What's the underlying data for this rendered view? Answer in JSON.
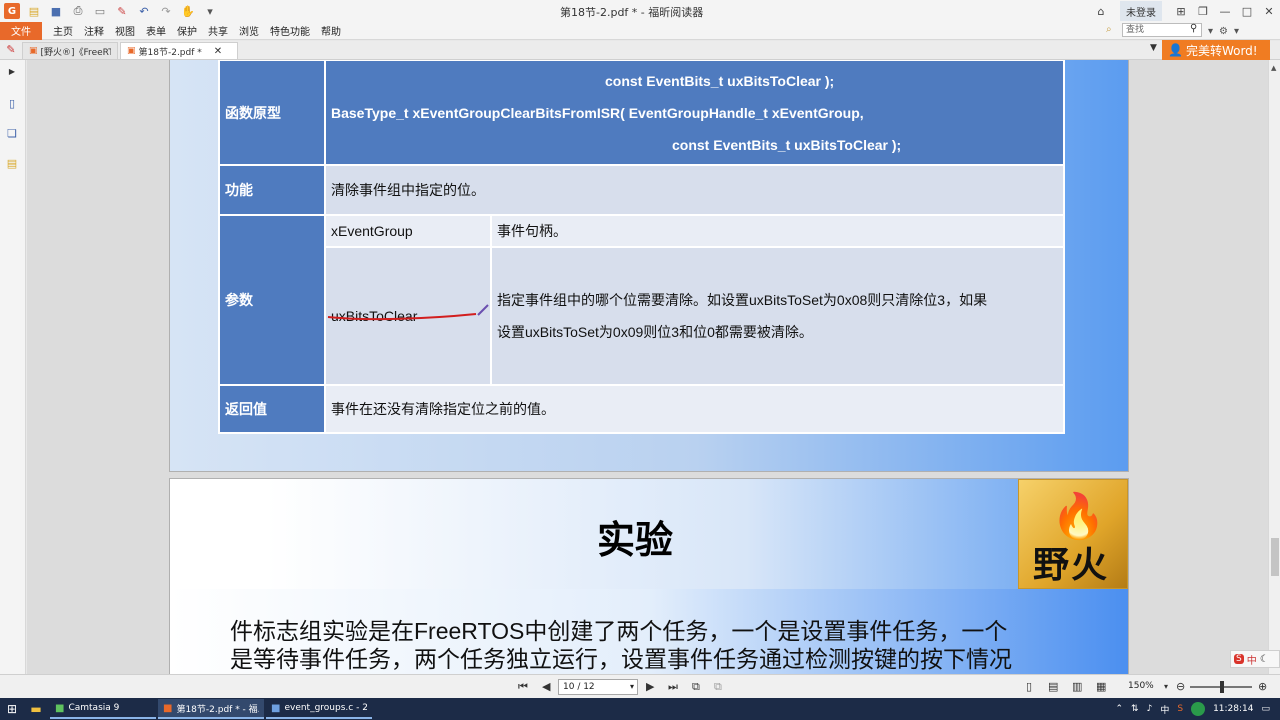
{
  "window": {
    "title": "第18节-2.pdf * - 福昕阅读器",
    "login_label": "未登录",
    "app_logo": "G"
  },
  "menu": {
    "file": "文件",
    "items": [
      "主页",
      "注释",
      "视图",
      "表单",
      "保护",
      "共享",
      "浏览",
      "特色功能",
      "帮助"
    ],
    "search_placeholder": "查找"
  },
  "tabs": [
    {
      "label": "[野火®]《FreeRTO...",
      "active": false
    },
    {
      "label": "第18节-2.pdf *",
      "active": true
    }
  ],
  "word_button": "完美转Word!",
  "table": {
    "proto_label": "函数原型",
    "proto_lines": [
      "const EventBits_t uxBitsToClear );",
      "BaseType_t xEventGroupClearBitsFromISR( EventGroupHandle_t xEventGroup,",
      "const EventBits_t uxBitsToClear );"
    ],
    "func_label": "功能",
    "func_text": "清除事件组中指定的位。",
    "param_label": "参数",
    "params": [
      {
        "name": "xEventGroup",
        "desc": "事件句柄。"
      },
      {
        "name": "uxBitsToClear",
        "desc_line1": "指定事件组中的哪个位需要清除。如设置uxBitsToSet为0x08则只清除位3，如果",
        "desc_line2": "设置uxBitsToSet为0x09则位3和位0都需要被清除。"
      }
    ],
    "return_label": "返回值",
    "return_text": "事件在还没有清除指定位之前的值。"
  },
  "slide2": {
    "title": "实验",
    "logo_text": "野火",
    "body_line1": "件标志组实验是在FreeRTOS中创建了两个任务，一个是设置事件任务，一个",
    "body_line2": "是等待事件任务，两个任务独立运行，设置事件任务通过检测按键的按下情况"
  },
  "statusbar": {
    "page": "10 / 12",
    "zoom": "150%"
  },
  "taskbar": {
    "items": [
      "Camtasia 9",
      "第18节-2.pdf * - 福...",
      "event_groups.c - 20..."
    ],
    "clock": "11:28:14",
    "ime_lang": "中"
  }
}
